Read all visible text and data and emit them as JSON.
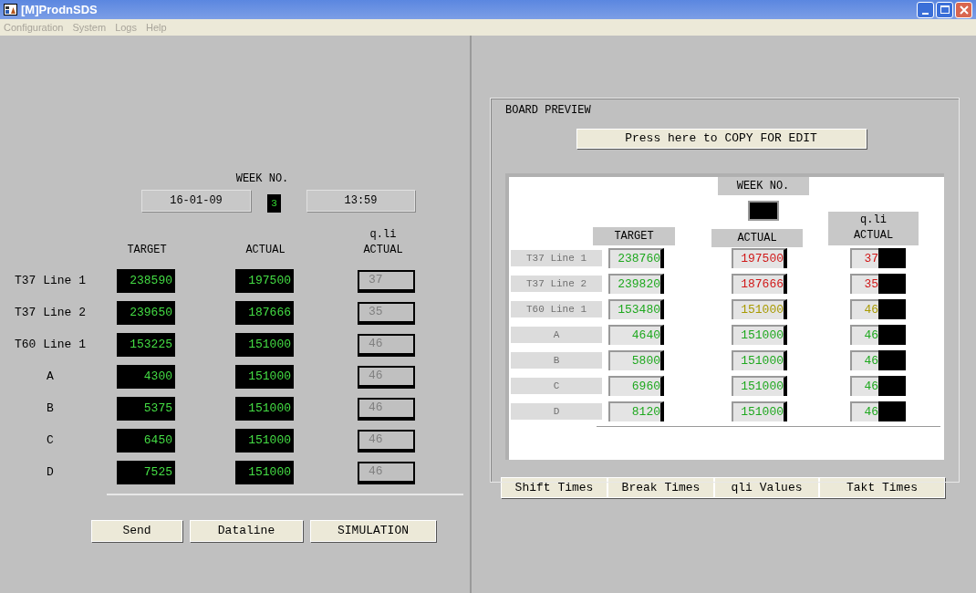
{
  "window": {
    "title": "[M]ProdnSDS"
  },
  "menu": [
    "Configuration",
    "System",
    "Logs",
    "Help"
  ],
  "entry": {
    "week_label": "WEEK NO.",
    "date": "16-01-09",
    "week": "3",
    "time": "13:59",
    "headers": {
      "target": "TARGET",
      "actual": "ACTUAL",
      "qli": "q.li\nACTUAL"
    },
    "rows": [
      {
        "label": "T37 Line 1",
        "target": "238590",
        "actual": "197500",
        "qli": "37",
        "qli_disabled": true
      },
      {
        "label": "T37 Line 2",
        "target": "239650",
        "actual": "187666",
        "qli": "35",
        "qli_disabled": true
      },
      {
        "label": "T60 Line 1",
        "target": "153225",
        "actual": "151000",
        "qli": "46",
        "qli_disabled": true
      },
      {
        "label": "A",
        "target": "4300",
        "actual": "151000",
        "qli": "46",
        "qli_disabled": true
      },
      {
        "label": "B",
        "target": "5375",
        "actual": "151000",
        "qli": "46",
        "qli_disabled": true
      },
      {
        "label": "C",
        "target": "6450",
        "actual": "151000",
        "qli": "46",
        "qli_disabled": true
      },
      {
        "label": "D",
        "target": "7525",
        "actual": "151000",
        "qli": "46",
        "qli_disabled": true
      }
    ],
    "buttons": [
      "Send",
      "Dataline",
      "SIMULATION"
    ]
  },
  "preview": {
    "title": "BOARD PREVIEW",
    "copy_button": "Press here to COPY FOR EDIT",
    "week_label": "WEEK NO.",
    "headers": {
      "target": "TARGET",
      "actual": "ACTUAL",
      "qli": "q.li\nACTUAL"
    },
    "rows": [
      {
        "label": "T37 Line 1",
        "cells": [
          {
            "text": "238760",
            "color": "#1ea81e"
          },
          {
            "text": "197500",
            "color": "#d01818"
          },
          {
            "text": "37",
            "color": "#d01818"
          }
        ]
      },
      {
        "label": "T37 Line 2",
        "cells": [
          {
            "text": "239820",
            "color": "#1ea81e"
          },
          {
            "text": "187666",
            "color": "#d01818"
          },
          {
            "text": "35",
            "color": "#d01818"
          }
        ]
      },
      {
        "label": "T60 Line 1",
        "cells": [
          {
            "text": "153480",
            "color": "#1ea81e"
          },
          {
            "text": "151000",
            "color": "#a89a00"
          },
          {
            "text": "46",
            "color": "#a89a00"
          }
        ]
      },
      {
        "label": "A",
        "cells": [
          {
            "text": "4640",
            "color": "#1ea81e"
          },
          {
            "text": "151000",
            "color": "#1ea81e"
          },
          {
            "text": "46",
            "color": "#1ea81e"
          }
        ]
      },
      {
        "label": "B",
        "cells": [
          {
            "text": "5800",
            "color": "#1ea81e"
          },
          {
            "text": "151000",
            "color": "#1ea81e"
          },
          {
            "text": "46",
            "color": "#1ea81e"
          }
        ]
      },
      {
        "label": "C",
        "cells": [
          {
            "text": "6960",
            "color": "#1ea81e"
          },
          {
            "text": "151000",
            "color": "#1ea81e"
          },
          {
            "text": "46",
            "color": "#1ea81e"
          }
        ]
      },
      {
        "label": "D",
        "cells": [
          {
            "text": "8120",
            "color": "#1ea81e"
          },
          {
            "text": "151000",
            "color": "#1ea81e"
          },
          {
            "text": "46",
            "color": "#1ea81e"
          }
        ]
      }
    ]
  },
  "preview_buttons": [
    "Shift Times",
    "Break Times",
    "qli Values",
    "Takt Times"
  ]
}
